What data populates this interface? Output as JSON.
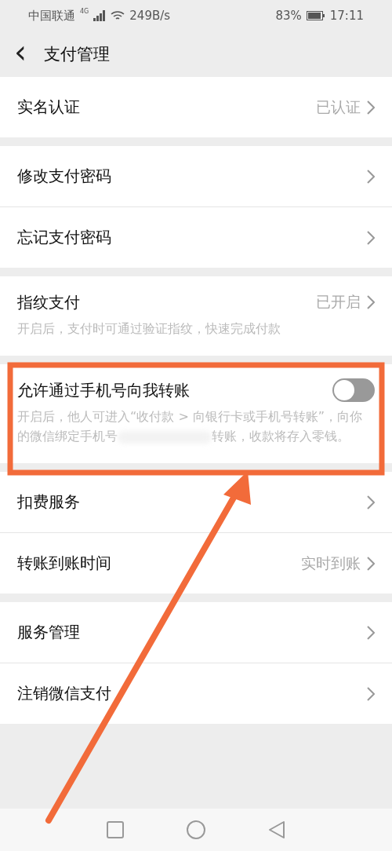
{
  "status_bar": {
    "carrier": "中国联通",
    "network": "4G",
    "speed": "249B/s",
    "battery": "83%",
    "time": "17:11"
  },
  "header": {
    "back": "‹",
    "title": "支付管理"
  },
  "sections": [
    {
      "items": [
        {
          "kind": "link",
          "label": "实名认证",
          "value": "已认证"
        }
      ]
    },
    {
      "items": [
        {
          "kind": "link",
          "label": "修改支付密码"
        },
        {
          "kind": "link",
          "label": "忘记支付密码"
        }
      ]
    },
    {
      "items": [
        {
          "kind": "link",
          "label": "指纹支付",
          "value": "已开启",
          "description": [
            "开启后，支付时可通过验证指纹，快速完成付款"
          ]
        }
      ]
    },
    {
      "items": [
        {
          "kind": "toggle",
          "label": "允许通过手机号向我转账",
          "on": false,
          "description": [
            "开启后，他人可进入“收付款 > 向银行卡或手机号转账”，向你的微信绑定手机号",
            "转账，收款将存入零钱。"
          ]
        }
      ]
    },
    {
      "items": [
        {
          "kind": "link",
          "label": "扣费服务"
        },
        {
          "kind": "link",
          "label": "转账到账时间",
          "value": "实时到账"
        }
      ]
    },
    {
      "items": [
        {
          "kind": "link",
          "label": "服务管理"
        },
        {
          "kind": "link",
          "label": "注销微信支付"
        }
      ]
    }
  ]
}
